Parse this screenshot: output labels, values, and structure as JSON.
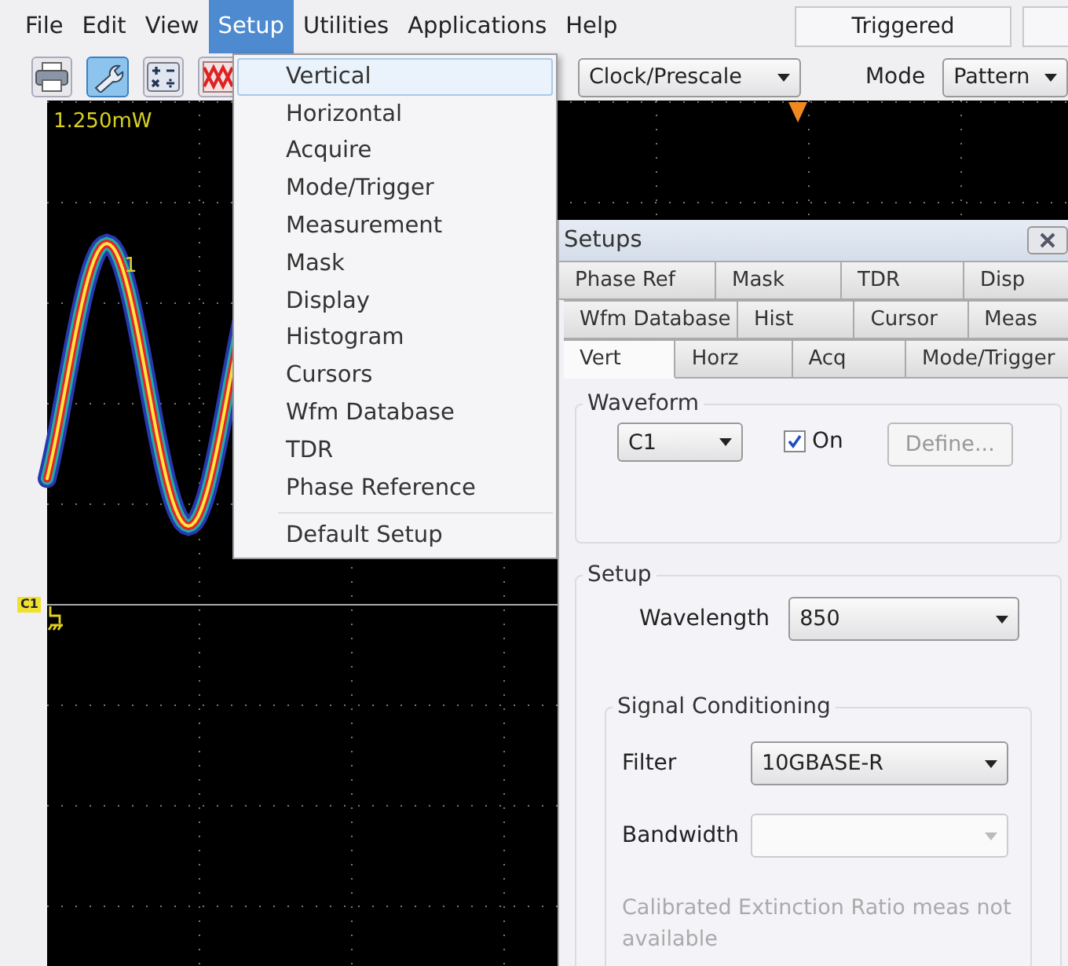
{
  "menu_bar": {
    "items": [
      {
        "label": "File",
        "selected": false
      },
      {
        "label": "Edit",
        "selected": false
      },
      {
        "label": "View",
        "selected": false
      },
      {
        "label": "Setup",
        "selected": true
      },
      {
        "label": "Utilities",
        "selected": false
      },
      {
        "label": "Applications",
        "selected": false
      },
      {
        "label": "Help",
        "selected": false
      }
    ],
    "status": "Triggered"
  },
  "toolbar": {
    "buttons": [
      {
        "kind": "printer",
        "selected": false
      },
      {
        "kind": "wrench",
        "selected": true
      },
      {
        "kind": "calculator",
        "selected": false
      },
      {
        "kind": "pattern",
        "selected": false
      }
    ],
    "source_select": {
      "value": "Clock/Prescale"
    },
    "mode_label": "Mode",
    "mode_select": {
      "value": "Pattern"
    }
  },
  "scope": {
    "scale_label": "1.250mW",
    "trace_label": "1",
    "channel_tag": "C1"
  },
  "setup_menu": {
    "items": [
      {
        "label": "Vertical",
        "selected": true
      },
      {
        "label": "Horizontal",
        "selected": false
      },
      {
        "label": "Acquire",
        "selected": false
      },
      {
        "label": "Mode/Trigger",
        "selected": false
      },
      {
        "label": "Measurement",
        "selected": false
      },
      {
        "label": "Mask",
        "selected": false
      },
      {
        "label": "Display",
        "selected": false
      },
      {
        "label": "Histogram",
        "selected": false
      },
      {
        "label": "Cursors",
        "selected": false
      },
      {
        "label": "Wfm Database",
        "selected": false
      },
      {
        "label": "TDR",
        "selected": false
      },
      {
        "label": "Phase Reference",
        "selected": false
      }
    ],
    "footer_items": [
      {
        "label": "Default Setup",
        "selected": false
      }
    ]
  },
  "dialog": {
    "title": "Setups",
    "tab_rows": [
      [
        {
          "label": "Phase Ref",
          "selected": false
        },
        {
          "label": "Mask",
          "selected": false
        },
        {
          "label": "TDR",
          "selected": false
        },
        {
          "label": "Disp",
          "selected": false
        }
      ],
      [
        {
          "label": "Wfm Database",
          "selected": false
        },
        {
          "label": "Hist",
          "selected": false
        },
        {
          "label": "Cursor",
          "selected": false
        },
        {
          "label": "Meas",
          "selected": false
        }
      ],
      [
        {
          "label": "Vert",
          "selected": true
        },
        {
          "label": "Horz",
          "selected": false
        },
        {
          "label": "Acq",
          "selected": false
        },
        {
          "label": "Mode/Trigger",
          "selected": false
        }
      ]
    ],
    "waveform": {
      "title": "Waveform",
      "source": "C1",
      "on_label": "On",
      "on_checked": true,
      "define_label": "Define...",
      "define_disabled": true
    },
    "setup": {
      "title": "Setup",
      "wavelength_label": "Wavelength",
      "wavelength": "850",
      "conditioning": {
        "title": "Signal Conditioning",
        "filter_label": "Filter",
        "filter": "10GBASE-R",
        "bandwidth_label": "Bandwidth",
        "bandwidth_disabled": true,
        "note": "Calibrated Extinction Ratio meas not available",
        "note_disabled": true
      }
    }
  }
}
